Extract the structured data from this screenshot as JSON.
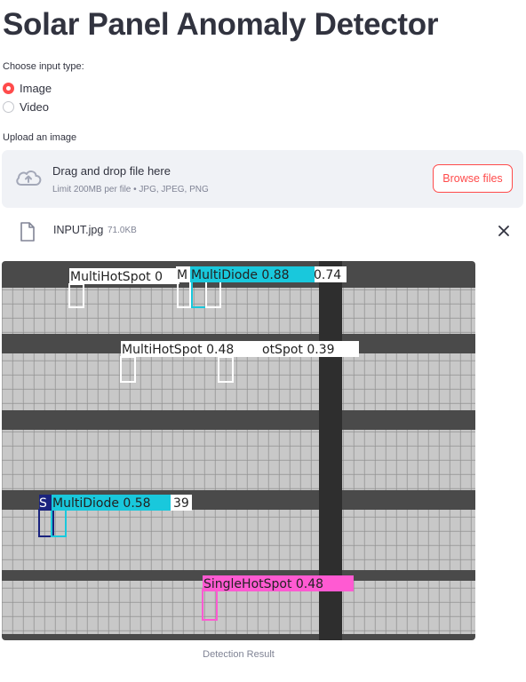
{
  "title": "Solar Panel Anomaly Detector",
  "input_type": {
    "label": "Choose input type:",
    "options": [
      "Image",
      "Video"
    ],
    "selected": "Image"
  },
  "uploader": {
    "label": "Upload an image",
    "drop_text": "Drag and drop file here",
    "limit_text": "Limit 200MB per file • JPG, JPEG, PNG",
    "browse_label": "Browse files"
  },
  "uploaded_file": {
    "name": "INPUT.jpg",
    "size": "71.0KB"
  },
  "detections": [
    {
      "label": "MultiHotSpot 0",
      "color": "#ffffff"
    },
    {
      "label": "M",
      "color": "#ffffff"
    },
    {
      "label": "MultiDiode 0.88",
      "color": "#19c8dc"
    },
    {
      "label": "0.74",
      "color": "#ffffff"
    },
    {
      "label": "MultiHotSpot 0.48",
      "color": "#ffffff"
    },
    {
      "label": "otSpot 0.39",
      "color": "#ffffff"
    },
    {
      "label": "S",
      "color": "#1a237e"
    },
    {
      "label": "MultiDiode 0.58",
      "color": "#19c8dc"
    },
    {
      "label": "39",
      "color": "#ffffff"
    },
    {
      "label": "SingleHotSpot 0.48",
      "color": "#ff5ad2"
    }
  ],
  "caption": "Detection Result",
  "colors": {
    "accent": "#ff4b4b",
    "text": "#31333f",
    "muted": "#808495",
    "dropzone_bg": "#f0f2f6"
  }
}
